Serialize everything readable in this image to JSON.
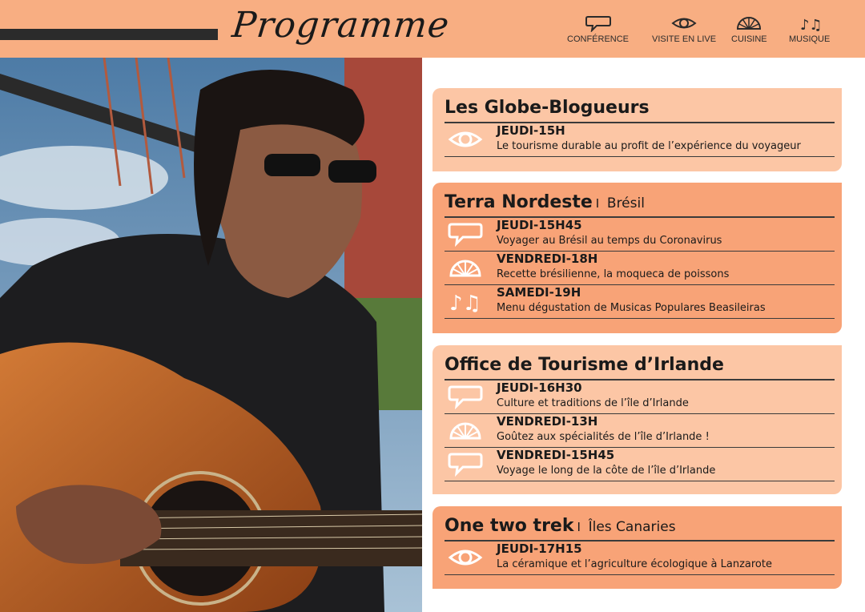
{
  "header": {
    "title": "Programme",
    "legend": [
      {
        "icon": "speech-bubble-icon",
        "label": "CONFÉRENCE"
      },
      {
        "icon": "eye-icon",
        "label": "VISITE EN LIVE"
      },
      {
        "icon": "fan-icon",
        "label": "CUISINE"
      },
      {
        "icon": "music-notes-icon",
        "label": "MUSIQUE"
      }
    ]
  },
  "colors": {
    "accent": "#f8ae82",
    "card_light": "#fcc6a5",
    "card_dark": "#f8a377",
    "text": "#1a1a1a"
  },
  "sections": [
    {
      "name": "Les Globe-Blogueurs",
      "location": "",
      "events": [
        {
          "icon": "eye-icon",
          "when": "JEUDI-15H",
          "what": "Le tourisme durable au profit de l’expérience du voyageur"
        }
      ]
    },
    {
      "name": "Terra Nordeste",
      "separator": "I",
      "location": "Brésil",
      "events": [
        {
          "icon": "speech-bubble-icon",
          "when": "JEUDI-15H45",
          "what": "Voyager au Brésil au temps du Coronavirus"
        },
        {
          "icon": "fan-icon",
          "when": "VENDREDI-18H",
          "what": "Recette brésilienne, la moqueca de poissons"
        },
        {
          "icon": "music-notes-icon",
          "when": "SAMEDI-19H",
          "what": "Menu dégustation de Musicas Populares Beasileiras"
        }
      ]
    },
    {
      "name": "Office de Tourisme d’Irlande",
      "location": "",
      "events": [
        {
          "icon": "speech-bubble-icon",
          "when": "JEUDI-16H30",
          "what": "Culture et traditions de l’île d’Irlande"
        },
        {
          "icon": "fan-icon",
          "when": "VENDREDI-13H",
          "what": "Goûtez aux spécialités de l’île d’Irlande !"
        },
        {
          "icon": "speech-bubble-icon",
          "when": "VENDREDI-15H45",
          "what": "Voyage le long de la côte de l’île d’Irlande"
        }
      ]
    },
    {
      "name": "One two trek",
      "separator": "I",
      "location": "Îles Canaries",
      "events": [
        {
          "icon": "eye-icon",
          "when": "JEUDI-17H15",
          "what": "La céramique et l’agriculture écologique à Lanzarote"
        }
      ]
    }
  ]
}
